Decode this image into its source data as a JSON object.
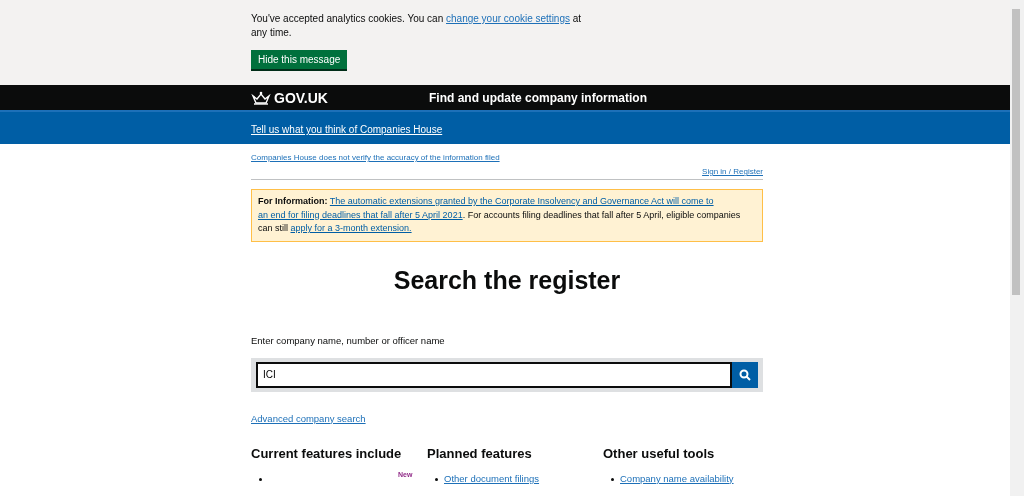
{
  "cookie_banner": {
    "text_before": "You've accepted analytics cookies. You can ",
    "link": "change your cookie settings",
    "text_after": " at any time.",
    "button": "Hide this message"
  },
  "header": {
    "logo": "GOV.UK",
    "service": "Find and update company information"
  },
  "feedback_bar": {
    "link": "Tell us what you think of Companies House"
  },
  "disclaimer_link": "Companies House does not verify the accuracy of the information filed",
  "sign_in_link": "Sign in / Register",
  "notice": {
    "label": "For Information:",
    "link1": [
      "The automatic extensions granted by the Corporate Insolvency and Governance Act will come to",
      "an end for filing deadlines that fall after 5 April 2021"
    ],
    "text": ". For accounts filing deadlines that fall after 5 April, eligible companies can still ",
    "link2": "apply for a 3-month extension."
  },
  "title": "Search the register",
  "search": {
    "label": "Enter company name, number or officer name",
    "value": "ICI"
  },
  "advanced_link": "Advanced company search",
  "columns": [
    {
      "heading": "Current features include",
      "items": [
        {
          "tag": "New"
        }
      ]
    },
    {
      "heading": "Planned features",
      "items": [
        {
          "text": "Other document filings"
        }
      ]
    },
    {
      "heading": "Other useful tools",
      "items": [
        {
          "text": "Company name availability"
        }
      ]
    }
  ]
}
